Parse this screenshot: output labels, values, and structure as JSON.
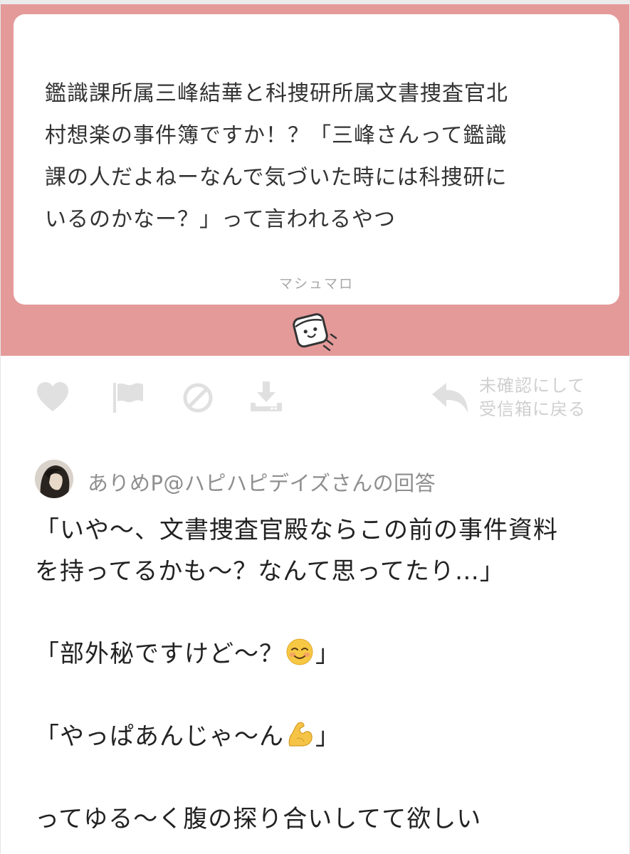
{
  "question": {
    "lines": [
      "鑑識課所属三峰結華と科捜研所属文書捜査官北",
      "村想楽の事件簿ですか！？「三峰さんって鑑識",
      "課の人だよねーなんで気づいた時には科捜研に",
      "いるのかなー？」って言われるやつ"
    ],
    "source": "マシュマロ",
    "card_bg": "#ffffff",
    "band_color": "#e59a9a"
  },
  "mascot": {
    "icon": "marshmallow-mascot-icon"
  },
  "actions": {
    "like": {
      "icon": "heart-icon"
    },
    "report": {
      "icon": "flag-icon"
    },
    "block": {
      "icon": "prohibited-icon"
    },
    "download": {
      "icon": "download-icon"
    },
    "mark_unread": {
      "icon": "reply-arrow-icon",
      "line1": "未確認にして",
      "line2": "受信箱に戻る"
    },
    "icon_color": "#e0e0e0"
  },
  "answer": {
    "answerer": "ありめP@ハピハピデイズさんの回答",
    "lines": [
      "「いや〜、文書捜査官殿ならこの前の事件資料",
      "を持ってるかも〜？なんて思ってたり…」",
      "",
      "「部外秘ですけど〜？",
      "",
      "「やっぱあんじゃ〜ん",
      "",
      "ってゆる〜く腹の探り合いしてて欲しい"
    ],
    "line4_close": "」",
    "line6_close": "」",
    "emoji1": "smiling-face-emoji",
    "emoji2": "flexed-biceps-emoji"
  }
}
